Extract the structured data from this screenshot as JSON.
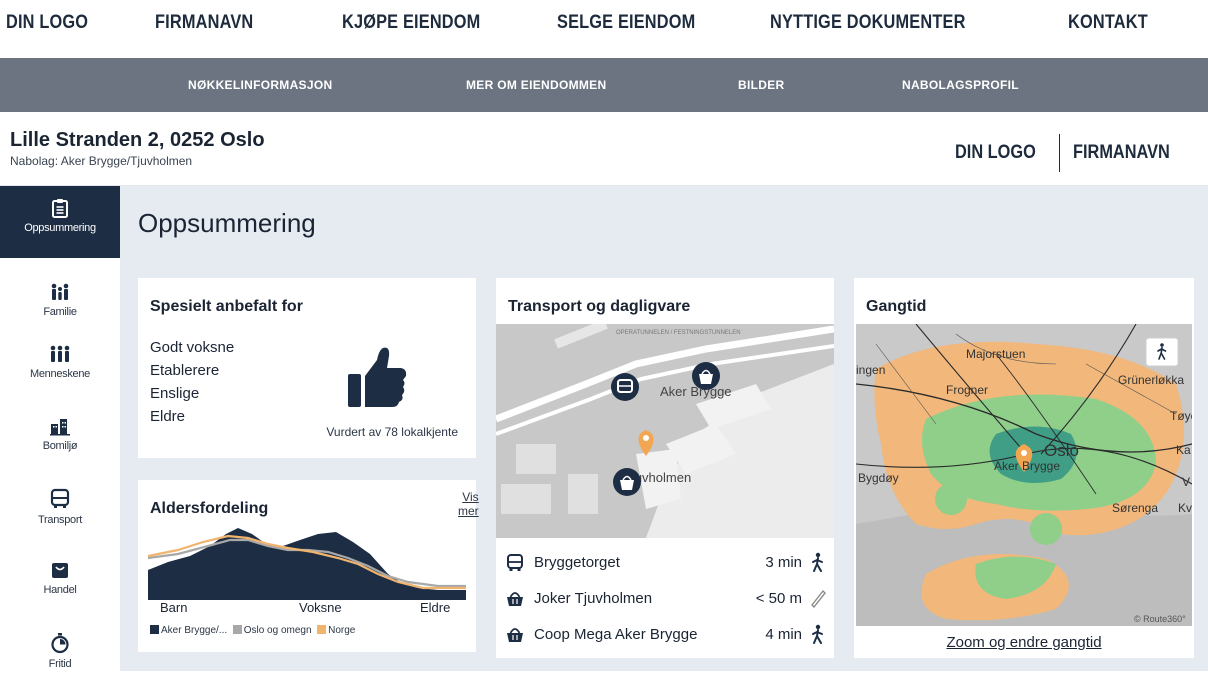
{
  "topnav": {
    "logo": "DIN LOGO",
    "items": [
      "FIRMANAVN",
      "KJØPE EIENDOM",
      "SELGE EIENDOM",
      "NYTTIGE DOKUMENTER",
      "KONTAKT"
    ]
  },
  "subnav": {
    "items": [
      "NØKKELINFORMASJON",
      "MER OM EIENDOMMEN",
      "BILDER",
      "NABOLAGSPROFIL"
    ]
  },
  "header": {
    "address": "Lille Stranden 2, 0252 Oslo",
    "neighborhood": "Nabolag: Aker Brygge/Tjuvholmen",
    "logo": "DIN LOGO",
    "company": "FIRMANAVN"
  },
  "sidebar": {
    "items": [
      {
        "label": "Oppsummering",
        "icon": "clipboard-icon",
        "active": true
      },
      {
        "label": "Familie",
        "icon": "family-icon",
        "active": false
      },
      {
        "label": "Menneskene",
        "icon": "people-icon",
        "active": false
      },
      {
        "label": "Bomiljø",
        "icon": "buildings-icon",
        "active": false
      },
      {
        "label": "Transport",
        "icon": "bus-icon",
        "active": false
      },
      {
        "label": "Handel",
        "icon": "shopping-bag-icon",
        "active": false
      },
      {
        "label": "Fritid",
        "icon": "stopwatch-icon",
        "active": false
      }
    ]
  },
  "main": {
    "title": "Oppsummering"
  },
  "recommended": {
    "title": "Spesielt anbefalt for",
    "items": [
      "Godt voksne",
      "Etablerere",
      "Enslige",
      "Eldre"
    ],
    "note": "Vurdert av 78 lokalkjente",
    "icon": "thumbs-up-icon"
  },
  "age": {
    "title": "Aldersfordeling",
    "more_line1": "Vis",
    "more_line2": "mer",
    "axis_labels": [
      "Barn",
      "Voksne",
      "Eldre"
    ],
    "legend": [
      "Aker Brygge/...",
      "Oslo og omegn",
      "Norge"
    ],
    "colors": {
      "area": "#1d2e44",
      "oslo": "#a8a8a8",
      "norge": "#f0b46e"
    }
  },
  "transport": {
    "title": "Transport og dagligvare",
    "map_labels": {
      "aker": "Aker Brygge",
      "tjuv": "Tjuvholmen",
      "tunnel": "OPERATUNNELEN / FESTNINGSTUNNELEN"
    },
    "rows": [
      {
        "icon": "bus-icon",
        "name": "Bryggetorget",
        "time": "3 min",
        "mode": "walk-icon"
      },
      {
        "icon": "basket-icon",
        "name": "Joker Tjuvholmen",
        "time": "< 50 m",
        "mode": "ruler-icon"
      },
      {
        "icon": "basket-icon",
        "name": "Coop Mega Aker Brygge",
        "time": "4 min",
        "mode": "walk-icon"
      }
    ]
  },
  "walk": {
    "title": "Gangtid",
    "labels": {
      "majorstuen": "Majorstuen",
      "ingen": "ingen",
      "frogner": "Frogner",
      "grunerlokka": "Grünerløkka",
      "toyen": "Tøye",
      "oslo": "Oslo",
      "aker": "Aker Brygge",
      "bygdoy": "Bygdøy",
      "sorenga": "Sørenga",
      "ka": "Ka",
      "kv": "Kv",
      "v": "V"
    },
    "credit": "© Route360°",
    "zoom_link": "Zoom og endre gangtid",
    "colors": {
      "orange": "#f2b77a",
      "green": "#8fcf8a",
      "dark": "#3f9e85",
      "pin": "#f3a652"
    }
  }
}
